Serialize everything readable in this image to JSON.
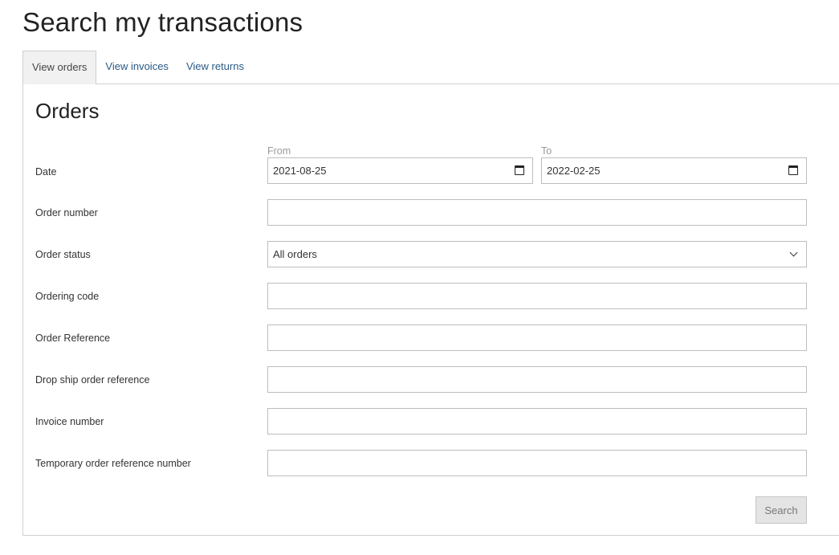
{
  "page": {
    "title": "Search my transactions"
  },
  "tabs": [
    {
      "label": "View orders",
      "active": true
    },
    {
      "label": "View invoices",
      "active": false
    },
    {
      "label": "View returns",
      "active": false
    }
  ],
  "orders": {
    "title": "Orders",
    "date": {
      "label": "Date",
      "from_caption": "From",
      "from_value": "2021-08-25",
      "to_caption": "To",
      "to_value": "2022-02-25"
    },
    "order_number": {
      "label": "Order number",
      "value": ""
    },
    "order_status": {
      "label": "Order status",
      "selected": "All orders"
    },
    "ordering_code": {
      "label": "Ordering code",
      "value": ""
    },
    "order_reference": {
      "label": "Order Reference",
      "value": ""
    },
    "drop_ship_reference": {
      "label": "Drop ship order reference",
      "value": ""
    },
    "invoice_number": {
      "label": "Invoice number",
      "value": ""
    },
    "temporary_reference": {
      "label": "Temporary order reference number",
      "value": ""
    },
    "search_label": "Search"
  },
  "icons": {
    "date_picker": "calendar-icon",
    "dropdown": "chevron-down-icon"
  }
}
